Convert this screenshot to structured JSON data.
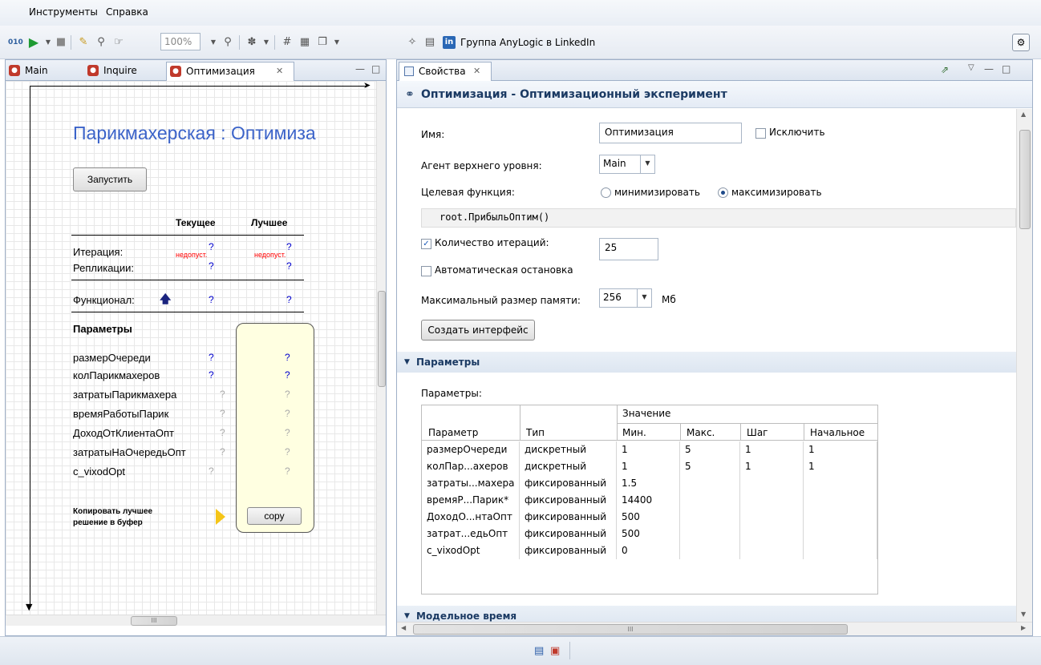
{
  "menu": [
    "Инструменты",
    "Справка"
  ],
  "toolbar": {
    "zoom": "100%",
    "linkedin": "Группа AnyLogic в LinkedIn"
  },
  "left_tabs": [
    "Main",
    "Inquire",
    "Оптимизация"
  ],
  "canvas": {
    "title": "Парикмахерская : Оптимиза",
    "run_button": "Запустить",
    "col_current": "Текущее",
    "col_best": "Лучшее",
    "iteration_label": "Итерация:",
    "replications_label": "Репликации:",
    "q": "?",
    "invalid": "недопуст.",
    "functional_label": "Функционал:",
    "params_header": "Параметры",
    "params": [
      "размерОчереди",
      "колПарикмахеров",
      "затратыПарикмахера",
      "времяРаботыПарик",
      "ДоходОтКлиентаОпт",
      "затратыНаОчередьОпт",
      "c_vixodOpt"
    ],
    "copy_label_1": "Копировать лучшее",
    "copy_label_2": "решение в буфер",
    "copy_button": "copy"
  },
  "right_tab": "Свойства",
  "props": {
    "title": "Оптимизация - Оптимизационный эксперимент",
    "name_label": "Имя:",
    "name_value": "Оптимизация",
    "exclude_label": "Исключить",
    "top_agent_label": "Агент верхнего уровня:",
    "top_agent_value": "Main",
    "objective_label": "Целевая функция:",
    "minimize": "минимизировать",
    "maximize": "максимизировать",
    "objective_expr": "root.ПрибыльОптим()",
    "iterations_label": "Количество итераций:",
    "iterations_value": "25",
    "autostop_label": "Автоматическая остановка",
    "memory_label": "Максимальный размер памяти:",
    "memory_value": "256",
    "memory_unit": "Мб",
    "create_ui_button": "Создать интерфейс",
    "section_params": "Параметры",
    "params_label": "Параметры:",
    "section_model_time": "Модельное время"
  },
  "table": {
    "group_header": "Значение",
    "headers": [
      "Параметр",
      "Тип",
      "Мин.",
      "Макс.",
      "Шаг",
      "Начальное"
    ],
    "rows": [
      [
        "размерОчереди",
        "дискретный",
        "1",
        "5",
        "1",
        "1"
      ],
      [
        "колПар...ахеров",
        "дискретный",
        "1",
        "5",
        "1",
        "1"
      ],
      [
        "затраты...махера",
        "фиксированный",
        "1.5",
        "",
        "",
        ""
      ],
      [
        "времяР...Парик*",
        "фиксированный",
        "14400",
        "",
        "",
        ""
      ],
      [
        "ДоходО...нтаОпт",
        "фиксированный",
        "500",
        "",
        "",
        ""
      ],
      [
        "затрат...едьОпт",
        "фиксированный",
        "500",
        "",
        "",
        ""
      ],
      [
        "c_vixodOpt",
        "фиксированный",
        "0",
        "",
        "",
        ""
      ]
    ]
  },
  "scroll_marker": "III"
}
